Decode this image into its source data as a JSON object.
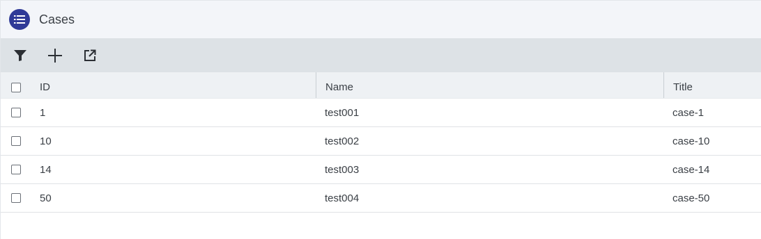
{
  "header": {
    "title": "Cases",
    "icon": "list-icon",
    "icon_color": "#2f3a97"
  },
  "toolbar": {
    "buttons": [
      {
        "icon": "filter-icon"
      },
      {
        "icon": "plus-icon"
      },
      {
        "icon": "external-link-icon"
      }
    ]
  },
  "table": {
    "columns": [
      "ID",
      "Name",
      "Title"
    ],
    "rows": [
      {
        "id": "1",
        "name": "test001",
        "title": "case-1"
      },
      {
        "id": "10",
        "name": "test002",
        "title": "case-10"
      },
      {
        "id": "14",
        "name": "test003",
        "title": "case-14"
      },
      {
        "id": "50",
        "name": "test004",
        "title": "case-50"
      }
    ]
  },
  "colors": {
    "header_bg": "#f3f5f9",
    "toolbar_bg": "#dde2e6",
    "table_header_bg": "#eef1f4",
    "accent": "#2f3a97"
  }
}
